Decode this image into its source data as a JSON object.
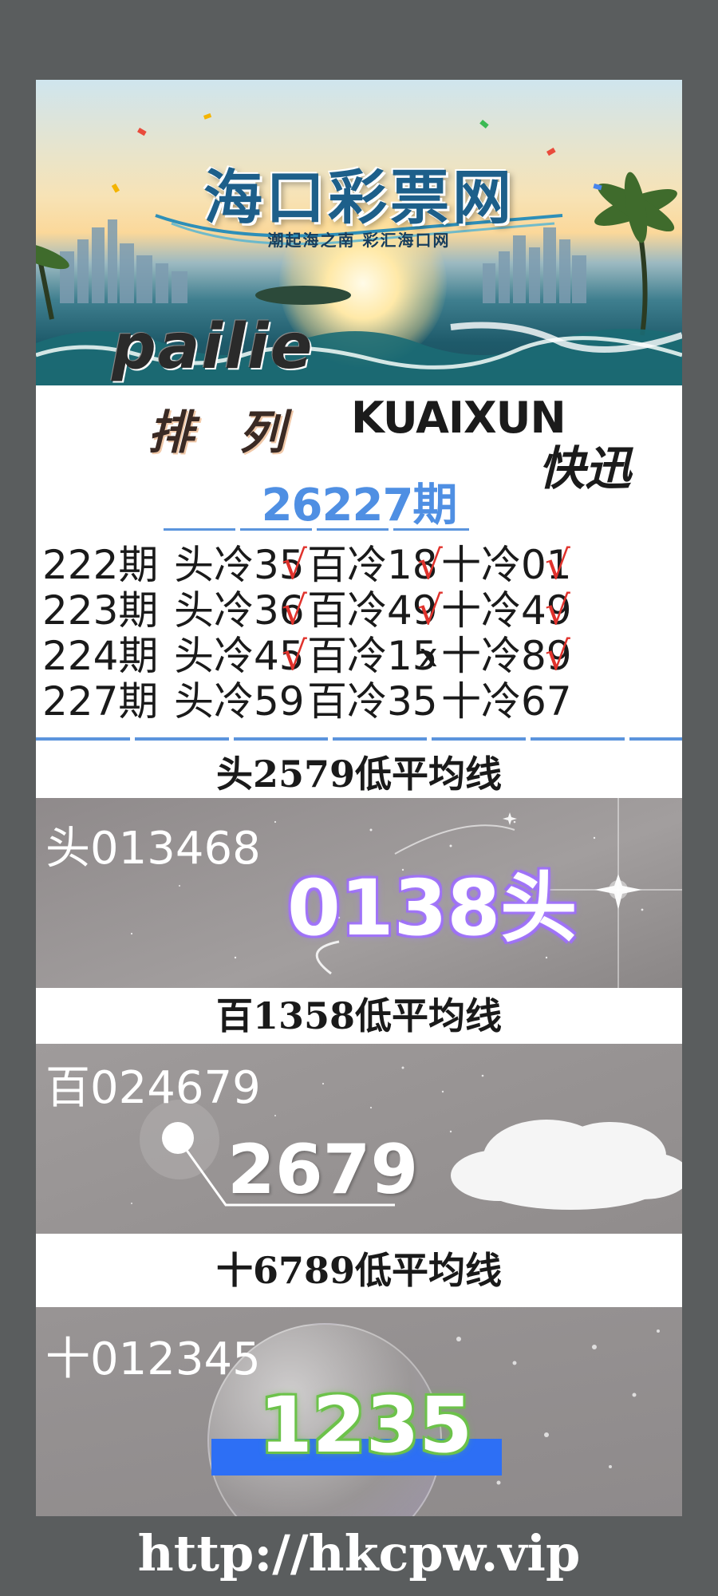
{
  "banner": {
    "title": "海口彩票网",
    "subtitle": "潮起海之南  彩汇海口网",
    "word": "pailie"
  },
  "header": {
    "pailie_cn": "排 列",
    "kuaixun": "KUAIXUN",
    "kuaixun_cn": "快迅",
    "issue": "26227期"
  },
  "history": [
    {
      "period": "222期",
      "head": "头冷35",
      "head_mark": "√",
      "hundred": "百冷18",
      "hundred_mark": "√",
      "ten": "十冷01",
      "ten_mark": "√"
    },
    {
      "period": "223期",
      "head": "头冷36",
      "head_mark": "√",
      "hundred": "百冷49",
      "hundred_mark": "√",
      "ten": "十冷49",
      "ten_mark": "√"
    },
    {
      "period": "224期",
      "head": "头冷45",
      "head_mark": "√",
      "hundred": "百冷15",
      "hundred_mark": "x",
      "ten": "十冷89",
      "ten_mark": "√"
    },
    {
      "period": "227期",
      "head": "头冷59",
      "head_mark": "",
      "hundred": "百冷35",
      "hundred_mark": "",
      "ten": "十冷67",
      "ten_mark": ""
    }
  ],
  "sections": [
    {
      "heading": "头2579低平均线",
      "source": "头013468",
      "pick": "0138头"
    },
    {
      "heading": "百1358低平均线",
      "source": "百024679",
      "pick": "2679"
    },
    {
      "heading": "十6789低平均线",
      "source": "十012345",
      "pick": "1235"
    }
  ],
  "footer": {
    "url": "http://hkcpw.vip"
  }
}
